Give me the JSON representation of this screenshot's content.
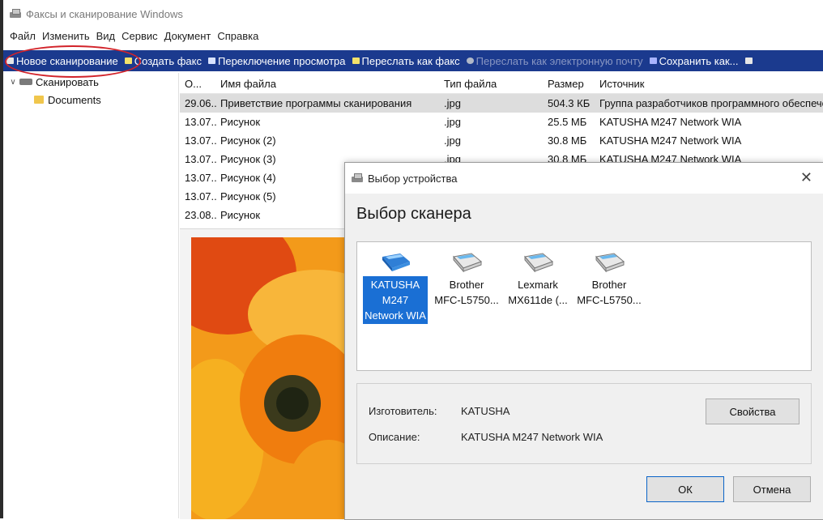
{
  "window": {
    "title": "Факсы и сканирование Windows",
    "icon": "fax-scanner-icon"
  },
  "menu": [
    "Файл",
    "Изменить",
    "Вид",
    "Сервис",
    "Документ",
    "Справка"
  ],
  "toolbar": {
    "new_scan": "Новое сканирование",
    "create_fax": "Создать факс",
    "toggle_view": "Переключение просмотра",
    "forward_fax": "Переслать как факс",
    "forward_email": "Переслать как электронную почту",
    "save_as": "Сохранить как..."
  },
  "colors": {
    "toolbar_bg": "#1b3a8e",
    "selection": "#1a6fd4",
    "annotation": "#d2232a"
  },
  "tree": {
    "root": "Сканировать",
    "child": "Documents"
  },
  "file_list": {
    "columns": [
      "О...",
      "Имя файла",
      "Тип файла",
      "Размер",
      "Источник"
    ],
    "rows": [
      {
        "date": "29.06....",
        "name": "Приветствие программы сканирования",
        "type": ".jpg",
        "size": "504.3 КБ",
        "source": "Группа разработчиков программного обеспечения"
      },
      {
        "date": "13.07....",
        "name": "Рисунок",
        "type": ".jpg",
        "size": "25.5 МБ",
        "source": "KATUSHA M247 Network WIA"
      },
      {
        "date": "13.07....",
        "name": "Рисунок (2)",
        "type": ".jpg",
        "size": "30.8 МБ",
        "source": "KATUSHA M247 Network WIA"
      },
      {
        "date": "13.07....",
        "name": "Рисунок (3)",
        "type": ".jpg",
        "size": "30.8 МБ",
        "source": "KATUSHA M247 Network WIA"
      },
      {
        "date": "13.07....",
        "name": "Рисунок (4)",
        "type": "",
        "size": "",
        "source": ""
      },
      {
        "date": "13.07....",
        "name": "Рисунок (5)",
        "type": "",
        "size": "",
        "source": ""
      },
      {
        "date": "23.08....",
        "name": "Рисунок",
        "type": "",
        "size": "",
        "source": ""
      }
    ]
  },
  "dialog": {
    "title": "Выбор устройства",
    "heading": "Выбор сканера",
    "devices": [
      {
        "line1": "KATUSHA",
        "line2": "M247",
        "line3": "Network WIA"
      },
      {
        "line1": "Brother",
        "line2": "MFC-L5750..."
      },
      {
        "line1": "Lexmark",
        "line2": "MX611de (..."
      },
      {
        "line1": "Brother",
        "line2": "MFC-L5750..."
      }
    ],
    "manufacturer_label": "Изготовитель:",
    "manufacturer_value": "KATUSHA",
    "description_label": "Описание:",
    "description_value": "KATUSHA M247 Network WIA",
    "properties_button": "Свойства",
    "ok_button": "ОК",
    "cancel_button": "Отмена"
  }
}
